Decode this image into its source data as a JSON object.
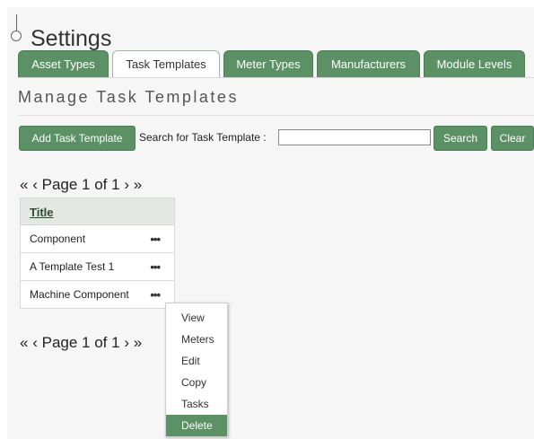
{
  "page": {
    "title": "Settings"
  },
  "tabs": [
    {
      "label": "Asset Types",
      "active": false
    },
    {
      "label": "Task Templates",
      "active": true
    },
    {
      "label": "Meter Types",
      "active": false
    },
    {
      "label": "Manufacturers",
      "active": false
    },
    {
      "label": "Module Levels",
      "active": false
    }
  ],
  "section": {
    "title": "Manage Task Templates"
  },
  "toolbar": {
    "add_label": "Add Task Template",
    "search_label": "Search for Task Template :",
    "search_value": "",
    "search_button": "Search",
    "clear_button": "Clear"
  },
  "pager": {
    "first": "«",
    "prev": "‹",
    "text": "Page 1 of 1",
    "next": "›",
    "last": "»"
  },
  "grid": {
    "column": "Title",
    "rows": [
      {
        "title": "Component",
        "actions": "•••"
      },
      {
        "title": "A Template Test 1",
        "actions": "•••"
      },
      {
        "title": "Machine Component",
        "actions": "•••"
      }
    ]
  },
  "context_menu": {
    "items": [
      "View",
      "Meters",
      "Edit",
      "Copy",
      "Tasks",
      "Delete"
    ],
    "highlighted": "Delete"
  },
  "colors": {
    "accent": "#5b9164",
    "tab_border": "#4d7f56",
    "header_bg": "#e3e8e3"
  }
}
